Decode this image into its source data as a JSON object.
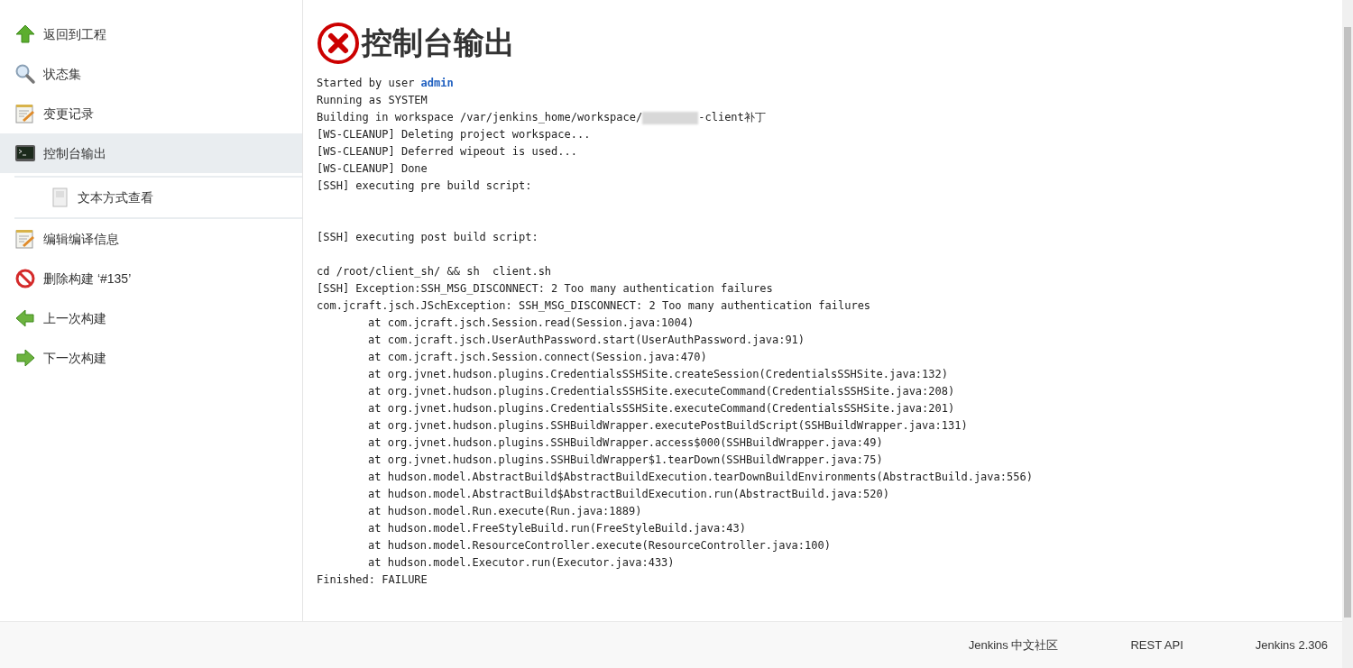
{
  "sidebar": {
    "items": [
      {
        "label": "返回到工程",
        "kind": "up",
        "selected": false
      },
      {
        "label": "状态集",
        "kind": "search",
        "selected": false
      },
      {
        "label": "变更记录",
        "kind": "notepad",
        "selected": false
      },
      {
        "label": "控制台输出",
        "kind": "terminal",
        "selected": true,
        "children": [
          {
            "label": "文本方式查看",
            "kind": "document",
            "selected": false
          }
        ]
      },
      {
        "label": "编辑编译信息",
        "kind": "notepad",
        "selected": false
      },
      {
        "label": "删除构建 ‘#135’",
        "kind": "prohibit",
        "selected": false
      },
      {
        "label": "上一次构建",
        "kind": "left",
        "selected": false
      },
      {
        "label": "下一次构建",
        "kind": "right",
        "selected": false
      }
    ]
  },
  "main": {
    "title": "控制台输出",
    "kind": "failure",
    "console": [
      {
        "kind": "user",
        "text": "Started by user ",
        "link": "admin"
      },
      {
        "kind": "text",
        "text": "Running as SYSTEM"
      },
      {
        "kind": "redacted",
        "text": "Building in workspace /var/jenkins_home/workspace/",
        "after": "-client补丁"
      },
      {
        "kind": "text",
        "text": "[WS-CLEANUP] Deleting project workspace..."
      },
      {
        "kind": "text",
        "text": "[WS-CLEANUP] Deferred wipeout is used..."
      },
      {
        "kind": "text",
        "text": "[WS-CLEANUP] Done"
      },
      {
        "kind": "text",
        "text": "[SSH] executing pre build script:"
      },
      {
        "kind": "blank"
      },
      {
        "kind": "blank"
      },
      {
        "kind": "text",
        "text": "[SSH] executing post build script:"
      },
      {
        "kind": "blank"
      },
      {
        "kind": "text",
        "text": "cd /root/client_sh/ && sh  client.sh"
      },
      {
        "kind": "text",
        "text": "[SSH] Exception:SSH_MSG_DISCONNECT: 2 Too many authentication failures"
      },
      {
        "kind": "text",
        "text": "com.jcraft.jsch.JSchException: SSH_MSG_DISCONNECT: 2 Too many authentication failures"
      },
      {
        "kind": "frame",
        "text": "at com.jcraft.jsch.Session.read(Session.java:1004)"
      },
      {
        "kind": "frame",
        "text": "at com.jcraft.jsch.UserAuthPassword.start(UserAuthPassword.java:91)"
      },
      {
        "kind": "frame",
        "text": "at com.jcraft.jsch.Session.connect(Session.java:470)"
      },
      {
        "kind": "frame",
        "text": "at org.jvnet.hudson.plugins.CredentialsSSHSite.createSession(CredentialsSSHSite.java:132)"
      },
      {
        "kind": "frame",
        "text": "at org.jvnet.hudson.plugins.CredentialsSSHSite.executeCommand(CredentialsSSHSite.java:208)"
      },
      {
        "kind": "frame",
        "text": "at org.jvnet.hudson.plugins.CredentialsSSHSite.executeCommand(CredentialsSSHSite.java:201)"
      },
      {
        "kind": "frame",
        "text": "at org.jvnet.hudson.plugins.SSHBuildWrapper.executePostBuildScript(SSHBuildWrapper.java:131)"
      },
      {
        "kind": "frame",
        "text": "at org.jvnet.hudson.plugins.SSHBuildWrapper.access$000(SSHBuildWrapper.java:49)"
      },
      {
        "kind": "frame",
        "text": "at org.jvnet.hudson.plugins.SSHBuildWrapper$1.tearDown(SSHBuildWrapper.java:75)"
      },
      {
        "kind": "frame",
        "text": "at hudson.model.AbstractBuild$AbstractBuildExecution.tearDownBuildEnvironments(AbstractBuild.java:556)"
      },
      {
        "kind": "frame",
        "text": "at hudson.model.AbstractBuild$AbstractBuildExecution.run(AbstractBuild.java:520)"
      },
      {
        "kind": "frame",
        "text": "at hudson.model.Run.execute(Run.java:1889)"
      },
      {
        "kind": "frame",
        "text": "at hudson.model.FreeStyleBuild.run(FreeStyleBuild.java:43)"
      },
      {
        "kind": "frame",
        "text": "at hudson.model.ResourceController.execute(ResourceController.java:100)"
      },
      {
        "kind": "frame",
        "text": "at hudson.model.Executor.run(Executor.java:433)"
      },
      {
        "kind": "text",
        "text": "Finished: FAILURE"
      }
    ]
  },
  "footer": {
    "links": [
      "Jenkins 中文社区",
      "REST API",
      "Jenkins 2.306"
    ]
  }
}
